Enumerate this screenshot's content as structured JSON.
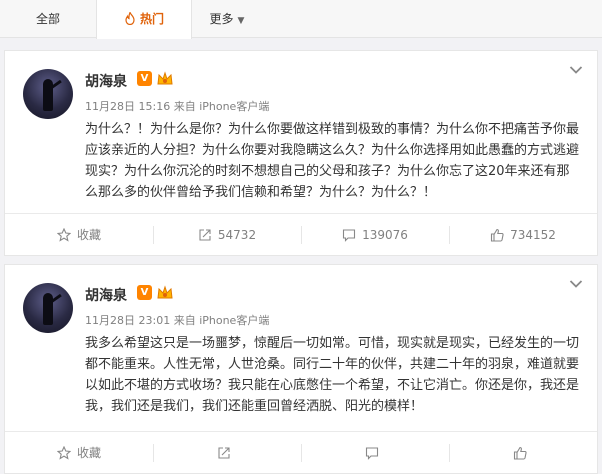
{
  "tabs": [
    {
      "label": "全部"
    },
    {
      "label": "热门",
      "icon": "fire-icon",
      "active": true
    },
    {
      "label": "更多",
      "icon": "chevron-down-icon"
    }
  ],
  "posts": [
    {
      "author": "胡海泉",
      "verified_badge": "V",
      "time": "11月28日 15:16",
      "source": "来自 iPhone客户端",
      "text": "为什么？！为什么是你？为什么你要做这样错到极致的事情？为什么你不把痛苦予你最应该亲近的人分担？为什么你要对我隐瞒这么久？为什么你选择用如此愚蠢的方式逃避现实？为什么你沉沦的时刻不想想自己的父母和孩子？为什么你忘了这20年来还有那么那么多的伙伴曾给予我们信赖和希望？为什么？为什么？！",
      "actions": {
        "favorite": "收藏",
        "repost": "54732",
        "comment": "139076",
        "like": "734152"
      }
    },
    {
      "author": "胡海泉",
      "verified_badge": "V",
      "time": "11月28日 23:01",
      "source": "来自 iPhone客户端",
      "text": "我多么希望这只是一场噩梦，惊醒后一切如常。可惜，现实就是现实，已经发生的一切都不能重来。人性无常，人世沧桑。同行二十年的伙伴，共建二十年的羽泉，难道就要以如此不堪的方式收场？我只能在心底憋住一个希望，不让它消亡。你还是你，我还是我，我们还是我们，我们还能重回曾经洒脱、阳光的模样！",
      "actions": {
        "favorite": "收藏",
        "repost": "",
        "comment": "",
        "like": ""
      }
    }
  ],
  "colors": {
    "accent": "#e0630b",
    "badge": "#ff8400",
    "text": "#333333",
    "meta": "#808080"
  }
}
